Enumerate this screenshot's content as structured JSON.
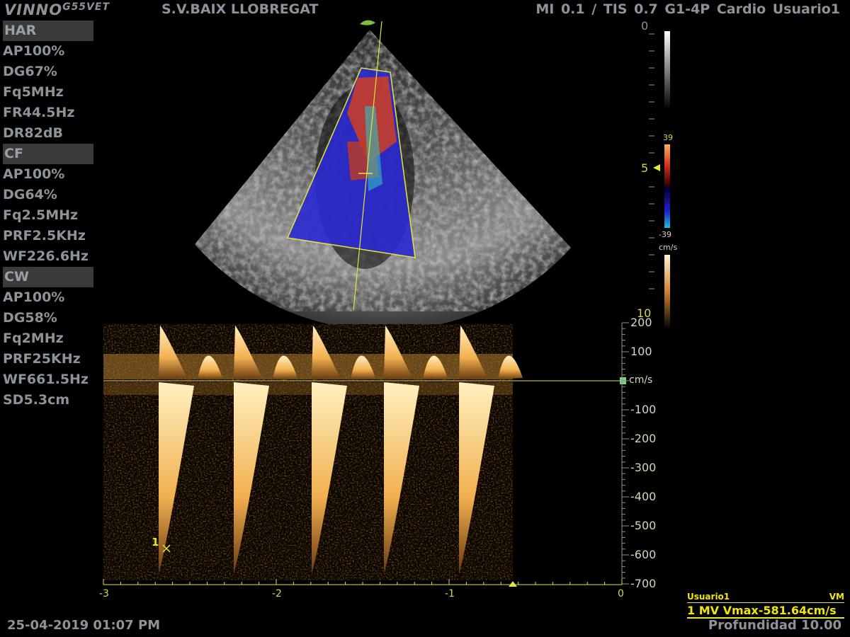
{
  "header": {
    "brand": "VINNO",
    "brand_model": "G55VET",
    "site": "S.V.BAIX LLOBREGAT",
    "status": "MI 0.1 / TIS 0.7   G1-4P   Cardio Usuario1"
  },
  "params": [
    {
      "text": "HAR",
      "header": true
    },
    {
      "text": "AP100%"
    },
    {
      "text": "DG67%"
    },
    {
      "text": "Fq5MHz"
    },
    {
      "text": "FR44.5Hz"
    },
    {
      "text": "DR82dB"
    },
    {
      "text": "CF",
      "header": true
    },
    {
      "text": "AP100%"
    },
    {
      "text": "DG64%"
    },
    {
      "text": "Fq2.5MHz"
    },
    {
      "text": "PRF2.5KHz"
    },
    {
      "text": "WF226.6Hz"
    },
    {
      "text": "CW",
      "header": true
    },
    {
      "text": "AP100%"
    },
    {
      "text": "DG58%"
    },
    {
      "text": "Fq2MHz"
    },
    {
      "text": "PRF25KHz"
    },
    {
      "text": "WF661.5Hz"
    },
    {
      "text": "SD5.3cm"
    }
  ],
  "depth_scale": {
    "top": "0",
    "mid": "5",
    "bottom": "10"
  },
  "color_scale": {
    "max": "39",
    "min": "-39",
    "unit": "cm/s"
  },
  "spectrum": {
    "unit": "cm/s",
    "y_ticks": [
      "200",
      "100",
      "-100",
      "-200",
      "-300",
      "-400",
      "-500",
      "-600",
      "-700"
    ],
    "x_ticks": [
      "-3",
      "-2",
      "-1",
      "0"
    ],
    "marker_label": "1",
    "colors": {
      "spectrum": "#f2c070",
      "scale": "#e5e53b"
    }
  },
  "measurement": {
    "user": "Usuario1",
    "mode": "VM",
    "result": "1 MV Vmax-581.64cm/s"
  },
  "footer": {
    "datetime": "25-04-2019 01:07 PM",
    "depth": "Profundidad 10.00"
  }
}
